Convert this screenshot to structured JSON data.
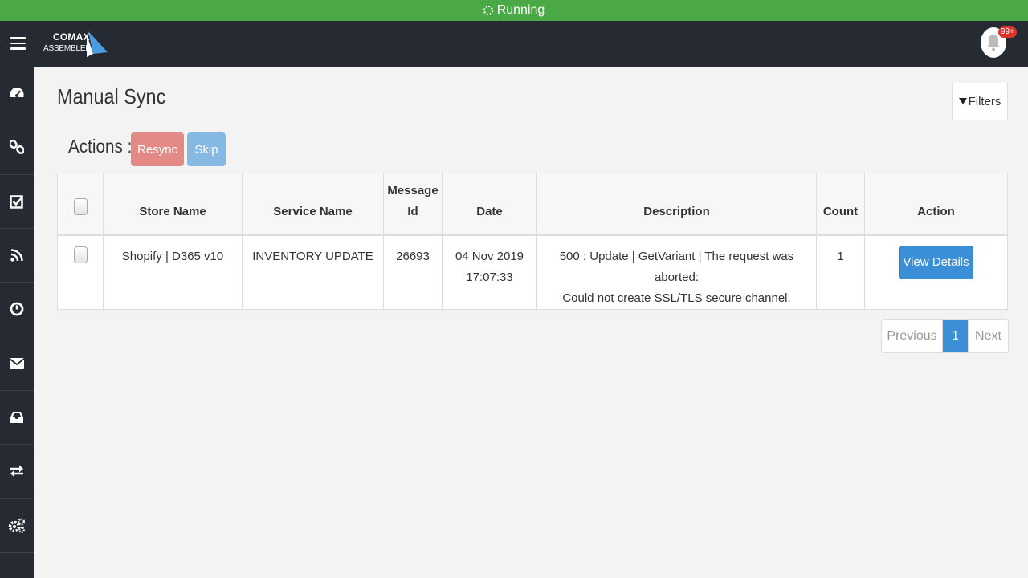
{
  "status": {
    "text": "Running",
    "color": "#4aa845"
  },
  "header": {
    "logo_line1": "COMAX",
    "logo_line2": "ASSEMBLER",
    "notification_badge": "99+"
  },
  "sidebar": {
    "items": [
      {
        "icon": "dashboard-icon"
      },
      {
        "icon": "link-icon"
      },
      {
        "icon": "checklist-icon"
      },
      {
        "icon": "rss-icon"
      },
      {
        "icon": "clock-icon"
      },
      {
        "icon": "envelope-icon"
      },
      {
        "icon": "inbox-icon"
      },
      {
        "icon": "exchange-icon"
      },
      {
        "icon": "gears-icon"
      }
    ]
  },
  "page": {
    "title": "Manual Sync",
    "filters_label": "Filters",
    "actions_label": "Actions :",
    "resync_label": "Resync",
    "skip_label": "Skip"
  },
  "table": {
    "headers": {
      "store_name": "Store Name",
      "service_name": "Service Name",
      "message_id_line1": "Message",
      "message_id_line2": "Id",
      "date": "Date",
      "description": "Description",
      "count": "Count",
      "action": "Action"
    },
    "rows": [
      {
        "store_name": "Shopify | D365 v10",
        "service_name": "INVENTORY UPDATE",
        "message_id": "26693",
        "date_line1": "04 Nov 2019",
        "date_line2": "17:07:33",
        "description_line1": "500 : Update | GetVariant | The request was aborted:",
        "description_line2": "Could not create SSL/TLS secure channel.",
        "count": "1",
        "action_label": "View Details"
      }
    ]
  },
  "pagination": {
    "previous": "Previous",
    "current": "1",
    "next": "Next"
  }
}
